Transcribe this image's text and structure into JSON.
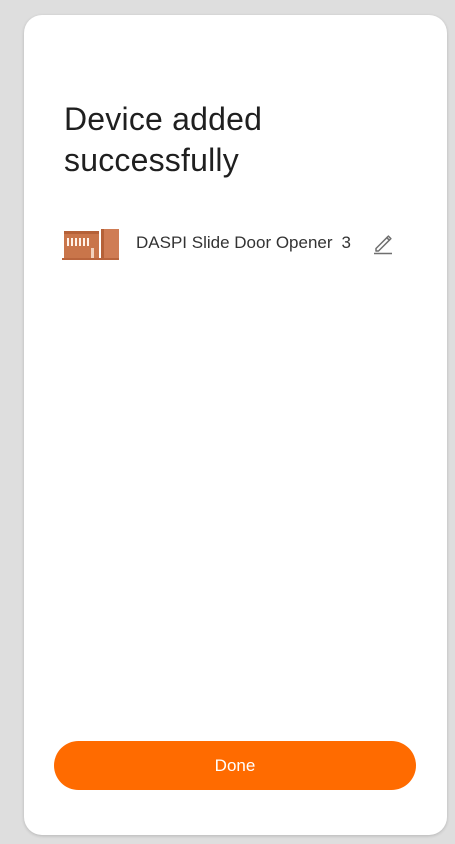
{
  "screen": {
    "title": "Device added successfully"
  },
  "device": {
    "name": "DASPI Slide Door Opener",
    "count": "3",
    "icon": "sliding-gate-icon",
    "edit_icon": "pencil-icon"
  },
  "actions": {
    "done_label": "Done"
  },
  "colors": {
    "accent": "#ff6b00",
    "background": "#dedede",
    "card": "#ffffff",
    "device_icon": "#c9754a"
  }
}
